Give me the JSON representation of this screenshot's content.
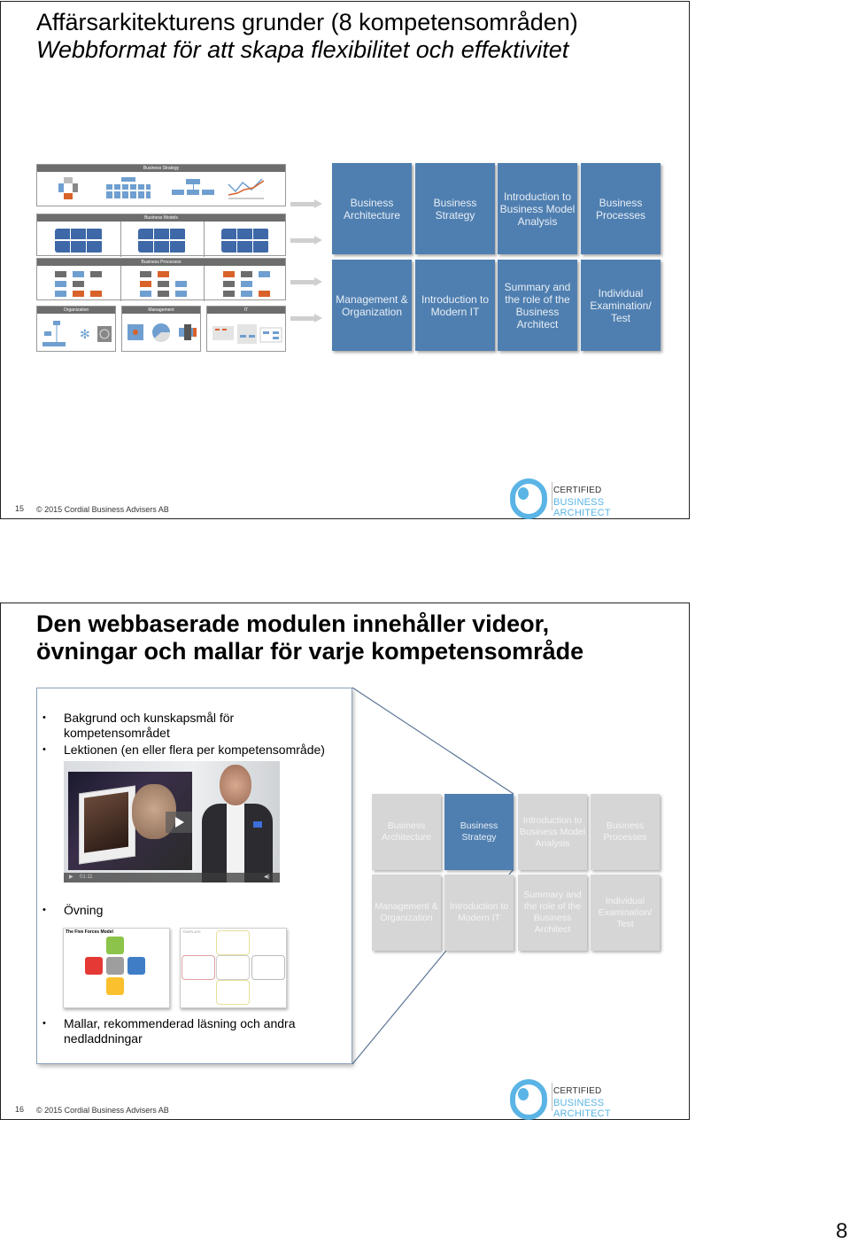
{
  "slide1": {
    "title": "Affärsarkitekturens grunder (8 kompetensområden)",
    "subtitle": "Webbformat för att skapa flexibilitet och effektivitet",
    "diagram": {
      "bands": {
        "business_strategy": "Business Strategy",
        "business_models": "Business Models",
        "business_processes": "Business Processes",
        "organization": "Organization",
        "management": "Management",
        "it": "IT"
      }
    },
    "tiles": [
      "Business Architecture",
      "Business Strategy",
      "Introduction to Business Model Analysis",
      "Business Processes",
      "Management & Organization",
      "Introduction to Modern IT",
      "Summary and the role of the Business Architect",
      "Individual Examination/ Test"
    ],
    "footer": {
      "slide_number": "15",
      "copyright": "© 2015 Cordial Business Advisers AB"
    }
  },
  "slide2": {
    "title_line1": "Den webbaserade modulen innehåller videor,",
    "title_line2": "övningar och mallar för  varje kompetensområde",
    "bullets": {
      "b1_line1": "Bakgrund och kunskapsmål för",
      "b1_line2": "kompetensområdet",
      "b2": "Lektionen (en eller flera per kompetensområde)",
      "b3": "Övning",
      "b4_line1": "Mallar, rekommenderad läsning och andra",
      "b4_line2": "nedladdningar"
    },
    "video": {
      "time": "01:11"
    },
    "thumbnails": {
      "five_forces_title": "The Five Forces Model",
      "template_title": "TEMPLATE"
    },
    "tiles": [
      {
        "label": "Business Architecture",
        "active": false
      },
      {
        "label": "Business Strategy",
        "active": true
      },
      {
        "label": "Introduction to Business Model Analysis",
        "active": false
      },
      {
        "label": "Business Processes",
        "active": false
      },
      {
        "label": "Management & Organization",
        "active": false
      },
      {
        "label": "Introduction to Modern IT",
        "active": false
      },
      {
        "label": "Summary and the role of the Business Architect",
        "active": false
      },
      {
        "label": "Individual Examination/ Test",
        "active": false
      }
    ],
    "footer": {
      "slide_number": "16",
      "copyright": "© 2015 Cordial Business Advisers AB"
    }
  },
  "logo": {
    "line1": "CERTIFIED",
    "line2": "BUSINESS ARCHITECT"
  },
  "page_number": "8",
  "colors": {
    "tile_blue": "#4f7fb0",
    "tile_grey": "#d6d6d6",
    "logo_blue": "#5ab4e5"
  }
}
